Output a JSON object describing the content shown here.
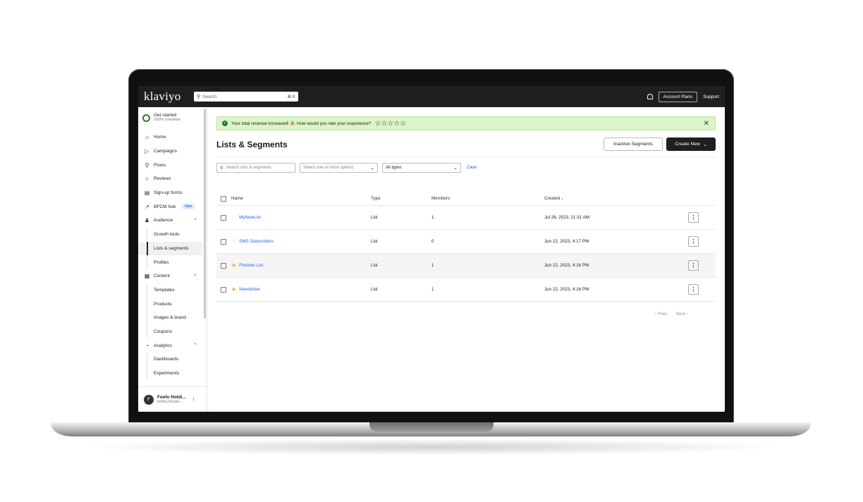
{
  "topbar": {
    "logo": "klaviyo",
    "search_placeholder": "Search",
    "search_shortcut": "⌘ K",
    "account_plans": "Account Plans",
    "support": "Support"
  },
  "sidebar": {
    "get_started": {
      "title": "Get started",
      "subtitle": "100% complete"
    },
    "items": [
      {
        "label": "Home",
        "icon": "home-icon",
        "level": 0
      },
      {
        "label": "Campaigns",
        "icon": "campaigns-icon",
        "level": 0
      },
      {
        "label": "Flows",
        "icon": "flows-icon",
        "level": 0
      },
      {
        "label": "Reviews",
        "icon": "star-icon",
        "level": 0
      },
      {
        "label": "Sign-up forms",
        "icon": "form-icon",
        "level": 0
      },
      {
        "label": "BFCM hub",
        "icon": "trend-icon",
        "level": 0,
        "badge": "New"
      },
      {
        "label": "Audience",
        "icon": "audience-icon",
        "level": 0,
        "expanded": true
      },
      {
        "label": "Growth tools",
        "level": 1
      },
      {
        "label": "Lists & segments",
        "level": 1,
        "active": true
      },
      {
        "label": "Profiles",
        "level": 1
      },
      {
        "label": "Content",
        "icon": "content-icon",
        "level": 0,
        "expanded": true
      },
      {
        "label": "Templates",
        "level": 1
      },
      {
        "label": "Products",
        "level": 1
      },
      {
        "label": "Images & brand",
        "level": 1
      },
      {
        "label": "Coupons",
        "level": 1
      },
      {
        "label": "Analytics",
        "icon": "analytics-icon",
        "level": 0,
        "expanded": true
      },
      {
        "label": "Dashboards",
        "level": 1
      },
      {
        "label": "Experiments",
        "level": 1
      }
    ],
    "user": {
      "initial": "F",
      "name": "Feefo Holdi...",
      "email": "bobby.thorpe..."
    }
  },
  "banner": {
    "text": "Your total revenue increased! 🎉 How would you rate your experience?",
    "stars": "☆☆☆☆☆"
  },
  "page": {
    "title": "Lists & Segments",
    "inactive_segments": "Inactive Segments",
    "create_new": "Create New"
  },
  "filters": {
    "search_placeholder": "Search lists & segments",
    "tags_placeholder": "Select one or more options",
    "type_value": "All types",
    "clear": "Clear"
  },
  "table": {
    "headers": {
      "name": "Name",
      "type": "Type",
      "members": "Members",
      "created": "Created ↓"
    },
    "rows": [
      {
        "name": "MyNewList",
        "type": "List",
        "members": "1",
        "created": "Jul 26, 2023, 11:31 AM",
        "starred": false
      },
      {
        "name": "SMS Subscribers",
        "type": "List",
        "members": "0",
        "created": "Jun 22, 2023, 4:17 PM",
        "starred": false
      },
      {
        "name": "Preview List",
        "type": "List",
        "members": "1",
        "created": "Jun 22, 2023, 4:16 PM",
        "starred": true,
        "highlighted": true
      },
      {
        "name": "Newsletter",
        "type": "List",
        "members": "1",
        "created": "Jun 22, 2023, 4:16 PM",
        "starred": true
      }
    ]
  },
  "pager": {
    "prev": "Prev",
    "next": "Next"
  }
}
